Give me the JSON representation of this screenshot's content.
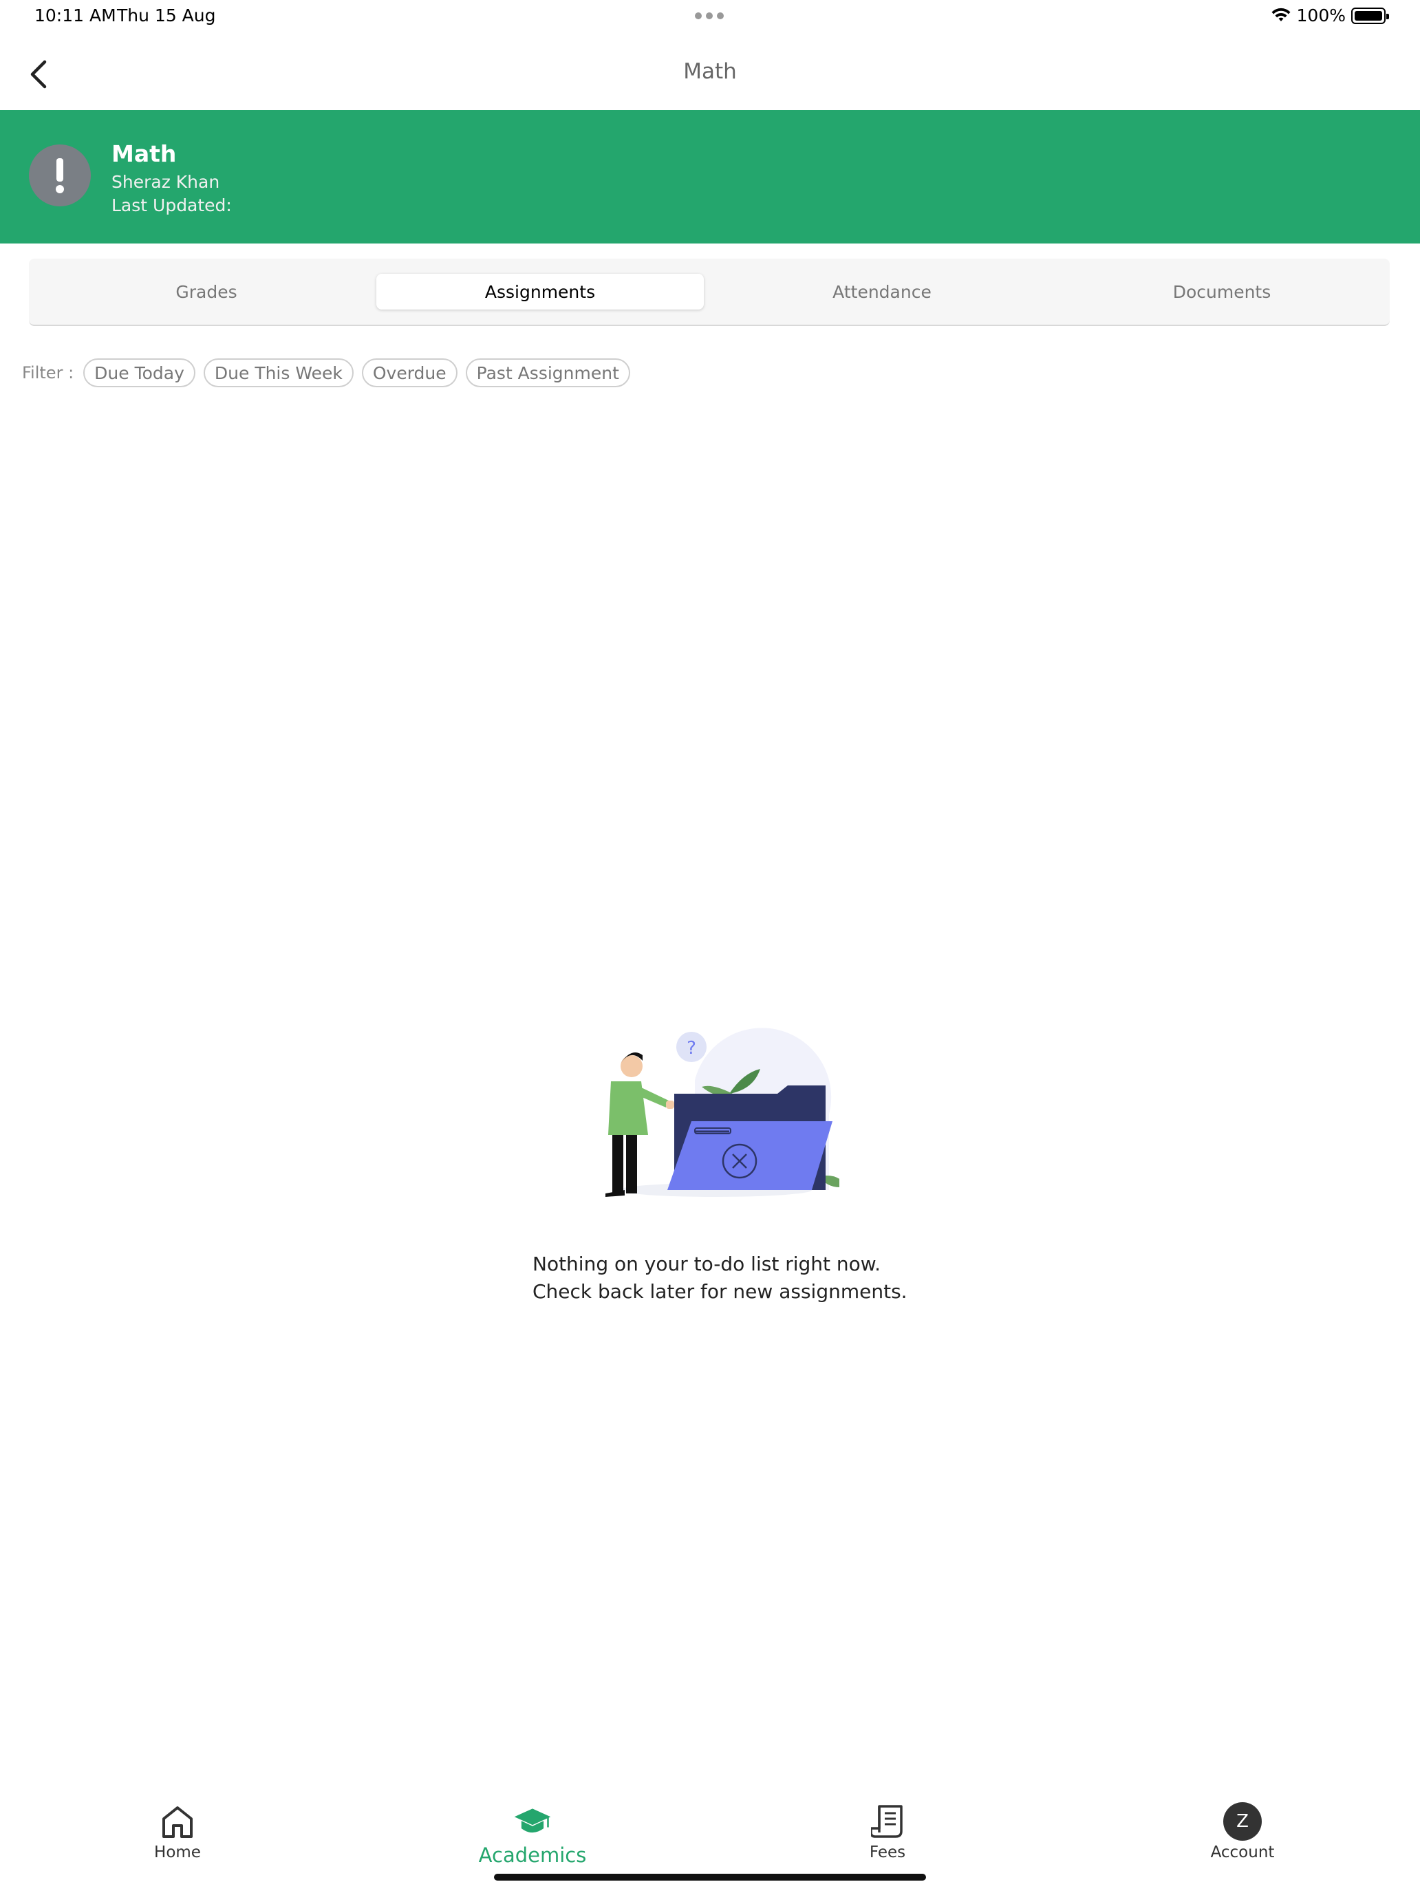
{
  "status_bar": {
    "time": "10:11 AM",
    "date": "Thu 15 Aug",
    "battery": "100%"
  },
  "nav": {
    "title": "Math",
    "back_icon": "chevron-left-icon"
  },
  "course": {
    "title": "Math",
    "teacher": "Sheraz Khan",
    "last_updated": "Last Updated:",
    "avatar_icon": "alert-icon"
  },
  "tabs": [
    {
      "label": "Grades",
      "active": false
    },
    {
      "label": "Assignments",
      "active": true
    },
    {
      "label": "Attendance",
      "active": false
    },
    {
      "label": "Documents",
      "active": false
    }
  ],
  "filter": {
    "label": "Filter :",
    "chips": [
      "Due Today",
      "Due This Week",
      "Overdue",
      "Past Assignment"
    ]
  },
  "empty_state": {
    "line1": "Nothing on your to-do list right now.",
    "line2": "Check back later for new assignments.",
    "illustration": "empty-folder-illustration"
  },
  "bottom_tabs": [
    {
      "label": "Home",
      "icon": "home-icon",
      "active": false
    },
    {
      "label": "Academics",
      "icon": "graduation-cap-icon",
      "active": true
    },
    {
      "label": "Fees",
      "icon": "receipt-icon",
      "active": false
    },
    {
      "label": "Account",
      "icon": "avatar",
      "avatar_letter": "Z",
      "active": false
    }
  ],
  "colors": {
    "brand_green": "#24a66d",
    "avatar_gray": "#7a7f85",
    "illustration_blue": "#6f7bf0",
    "illustration_navy": "#2d3566"
  }
}
